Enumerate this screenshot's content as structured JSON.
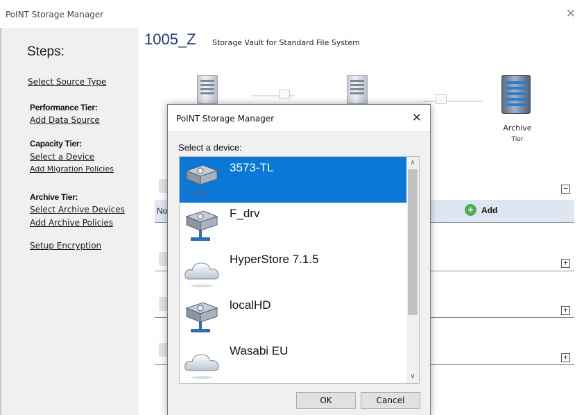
{
  "window": {
    "title": "PoINT Storage Manager",
    "close_glyph": "✕"
  },
  "sidebar": {
    "heading": "Steps:",
    "select_source_type": "Select Source Type",
    "performance_tier": {
      "label": "Performance Tier:",
      "add_data_source": "Add Data Source"
    },
    "capacity_tier": {
      "label": "Capacity Tier:",
      "select_device": "Select a Device",
      "add_migration_policies": "Add Migration Policies"
    },
    "archive_tier": {
      "label": "Archive Tier:",
      "select_archive_devices": "Select Archive Devices",
      "add_archive_policies": "Add Archive Policies"
    },
    "setup_encryption": "Setup Encryption"
  },
  "header": {
    "vault_name": "1005_Z",
    "vault_description": "Storage Vault for Standard File System"
  },
  "tier_diagram": {
    "archive_label": "Archive",
    "archive_sub": "Tier"
  },
  "section": {
    "row_text_fragment": "No",
    "add_label": "Add",
    "collapse_glyph": "−",
    "expand_glyph": "+"
  },
  "dialog": {
    "title": "PoINT Storage Manager",
    "close_glyph": "✕",
    "prompt": "Select a device:",
    "devices": [
      {
        "name": "3573-TL",
        "icon": "tape-library-icon",
        "selected": true
      },
      {
        "name": "F_drv",
        "icon": "network-drive-icon",
        "selected": false
      },
      {
        "name": "HyperStore 7.1.5",
        "icon": "cloud-icon",
        "selected": false
      },
      {
        "name": "localHD",
        "icon": "network-drive-icon",
        "selected": false
      },
      {
        "name": "Wasabi EU",
        "icon": "cloud-icon",
        "selected": false
      }
    ],
    "ok_label": "OK",
    "cancel_label": "Cancel",
    "scroll_up_glyph": "∧",
    "scroll_down_glyph": "∨"
  },
  "colors": {
    "selection": "#0a78d7",
    "title_blue": "#1c3a6e",
    "add_green": "#4caf50"
  }
}
